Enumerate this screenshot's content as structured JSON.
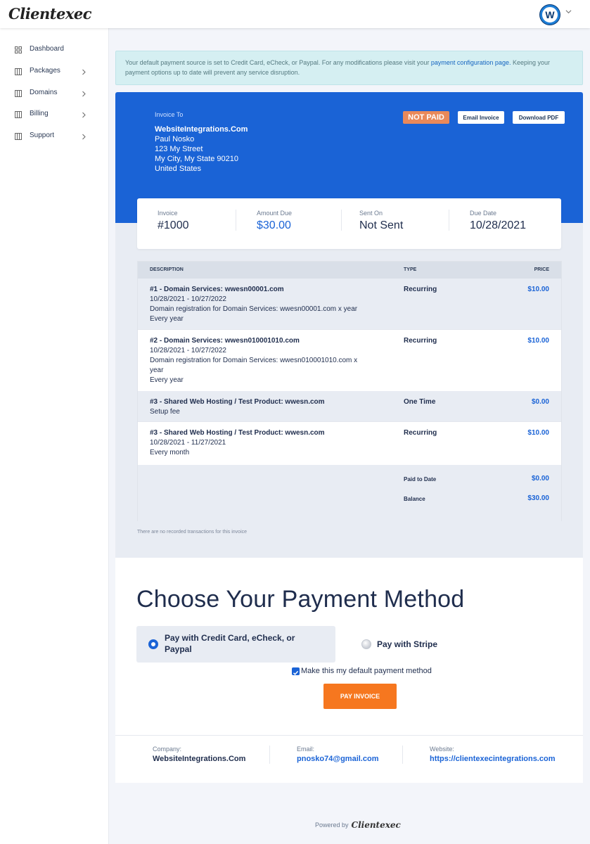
{
  "header": {
    "logo_text": "Clientexec",
    "avatar_initial": "W"
  },
  "sidebar": {
    "items": [
      {
        "label": "Dashboard",
        "icon": "grid-icon",
        "has_submenu": false
      },
      {
        "label": "Packages",
        "icon": "columns-icon",
        "has_submenu": true
      },
      {
        "label": "Domains",
        "icon": "columns-icon",
        "has_submenu": true
      },
      {
        "label": "Billing",
        "icon": "columns-icon",
        "has_submenu": true
      },
      {
        "label": "Support",
        "icon": "columns-icon",
        "has_submenu": true
      }
    ]
  },
  "alert": {
    "text_before": "Your default payment source is set to Credit Card, eCheck, or Paypal. For any modifications please visit your ",
    "link_text": "payment configuration page.",
    "text_after": " Keeping your payment options up to date will prevent any service disruption."
  },
  "invoice": {
    "to_label": "Invoice To",
    "company": "WebsiteIntegrations.Com",
    "address_lines": [
      "Paul Nosko",
      "123 My Street",
      "My City, My State 90210",
      "United States"
    ],
    "status": "NOT PAID",
    "email_button": "Email Invoice",
    "pdf_button": "Download PDF",
    "summary": {
      "invoice_label": "Invoice",
      "invoice_value": "#1000",
      "amount_label": "Amount Due",
      "amount_value": "$30.00",
      "sent_label": "Sent On",
      "sent_value": "Not Sent",
      "due_label": "Due Date",
      "due_value": "10/28/2021"
    },
    "table": {
      "headers": {
        "description": "DESCRIPTION",
        "type": "TYPE",
        "price": "PRICE"
      },
      "rows": [
        {
          "lines": [
            "#1 - Domain Services: wwesn00001.com",
            "10/28/2021 - 10/27/2022",
            "Domain registration for Domain Services: wwesn00001.com x year",
            "Every year"
          ],
          "type": "Recurring",
          "price": "$10.00"
        },
        {
          "lines": [
            "#2 - Domain Services: wwesn010001010.com",
            "10/28/2021 - 10/27/2022",
            "Domain registration for Domain Services: wwesn010001010.com x",
            "year",
            "Every year"
          ],
          "type": "Recurring",
          "price": "$10.00"
        },
        {
          "lines": [
            "#3 - Shared Web Hosting / Test Product: wwesn.com",
            "Setup fee"
          ],
          "type": "One Time",
          "price": "$0.00"
        },
        {
          "lines": [
            "#3 - Shared Web Hosting / Test Product: wwesn.com",
            "10/28/2021 - 11/27/2021",
            "Every month"
          ],
          "type": "Recurring",
          "price": "$10.00"
        }
      ],
      "paid_to_date_label": "Paid to Date",
      "paid_to_date_value": "$0.00",
      "balance_label": "Balance",
      "balance_value": "$30.00"
    },
    "no_transactions": "There are no recorded transactions for this invoice"
  },
  "payment": {
    "title": "Choose Your Payment Method",
    "option1_line1": "Pay with Credit Card, eCheck, or",
    "option1_line2": "Paypal",
    "option2": "Pay with Stripe",
    "selected_option": "option1",
    "default_checkbox_label": "Make this my default payment method",
    "default_checked": true,
    "pay_button": "PAY INVOICE"
  },
  "footer_info": {
    "company_label": "Company:",
    "company_value": "WebsiteIntegrations.Com",
    "email_label": "Email:",
    "email_value": "pnosko74@gmail.com",
    "website_label": "Website:",
    "website_value": "https://clientexecintegrations.com"
  },
  "powered_by": {
    "label": "Powered by",
    "brand": "Clientexec"
  },
  "colors": {
    "primary_blue": "#1a63d6",
    "not_paid_badge": "#e9895a",
    "pay_button": "#f6771f",
    "alert_bg": "#d5eff2"
  }
}
